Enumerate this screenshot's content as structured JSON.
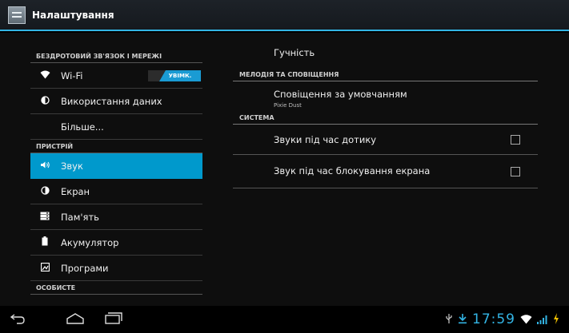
{
  "header": {
    "title": "Налаштування"
  },
  "sidebar": {
    "section_wireless": "БЕЗДРОТОВИЙ ЗВ'ЯЗОК І МЕРЕЖІ",
    "wifi": {
      "label": "Wi-Fi",
      "toggle": "УВІМК.",
      "state": "on"
    },
    "data_usage": "Використання даних",
    "more": "Більше...",
    "section_device": "ПРИСТРІЙ",
    "sound": "Звук",
    "display": "Екран",
    "storage": "Пам'ять",
    "battery": "Акумулятор",
    "apps": "Програми",
    "section_personal": "ОСОБИСТЕ"
  },
  "main": {
    "volume": "Гучність",
    "section_ringtone": "МЕЛОДІЯ ТА СПОВІЩЕННЯ",
    "default_notification": {
      "title": "Сповіщення за умовчанням",
      "summary": "Pixie Dust"
    },
    "section_system": "СИСТЕМА",
    "touch_sounds": {
      "title": "Звуки під час дотику",
      "checked": false
    },
    "screen_lock_sound": {
      "title": "Звук під час блокування екрана",
      "checked": false
    }
  },
  "statusbar": {
    "time": "17:59"
  },
  "colors": {
    "accent": "#33b5e5",
    "selected": "#0099cc",
    "toggle_on": "#1a9bd3"
  },
  "icons": {
    "app": "settings-icon",
    "wifi": "wifi-icon",
    "data_usage": "data-usage-icon",
    "sound": "speaker-icon",
    "display": "brightness-icon",
    "storage": "storage-icon",
    "battery": "battery-icon",
    "apps": "apps-icon",
    "nav_back": "back-icon",
    "nav_home": "home-icon",
    "nav_recents": "recents-icon",
    "usb": "usb-icon",
    "download": "download-icon",
    "signal": "signal-icon",
    "charging": "charging-icon"
  }
}
